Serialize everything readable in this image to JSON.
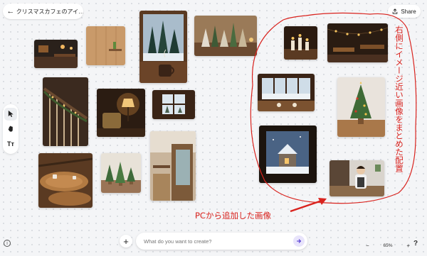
{
  "header": {
    "title": "クリスマスカフェのアイ…",
    "share_label": "Share"
  },
  "toolbar": {
    "tools": [
      {
        "name": "select",
        "icon": "cursor-icon"
      },
      {
        "name": "hand",
        "icon": "hand-icon"
      },
      {
        "name": "text",
        "icon": "text-icon",
        "label": "Tт"
      }
    ]
  },
  "canvas": {
    "images": [
      {
        "subject": "dark wooden cafe interior with bar"
      },
      {
        "subject": "wooden wall with small shelf"
      },
      {
        "subject": "snowy forest through window with mug"
      },
      {
        "subject": "miniature christmas trees on shelf"
      },
      {
        "subject": "wooden staircase with garland"
      },
      {
        "subject": "warm lamp and armchair"
      },
      {
        "subject": "window with snowy view"
      },
      {
        "subject": "wooden booth seating"
      },
      {
        "subject": "wooden tables with cups"
      },
      {
        "subject": "small potted trees"
      },
      {
        "subject": "candles on table"
      },
      {
        "subject": "cafe interior with string lights"
      },
      {
        "subject": "window view of snowy landscape"
      },
      {
        "subject": "small decorated christmas tree"
      },
      {
        "subject": "snowy night house through window"
      },
      {
        "subject": "barista in cafe"
      }
    ]
  },
  "annotations": {
    "vertical_note": "右側にイメージ近い画像をまとめた配置",
    "pc_note": "PCから追加した画像",
    "color": "#d9231e"
  },
  "prompt": {
    "placeholder": "What do you want to create?"
  },
  "zoom": {
    "minus": "−",
    "value": "65%",
    "plus": "+"
  },
  "help_label": "?",
  "info_label": "i",
  "add_label": "+"
}
